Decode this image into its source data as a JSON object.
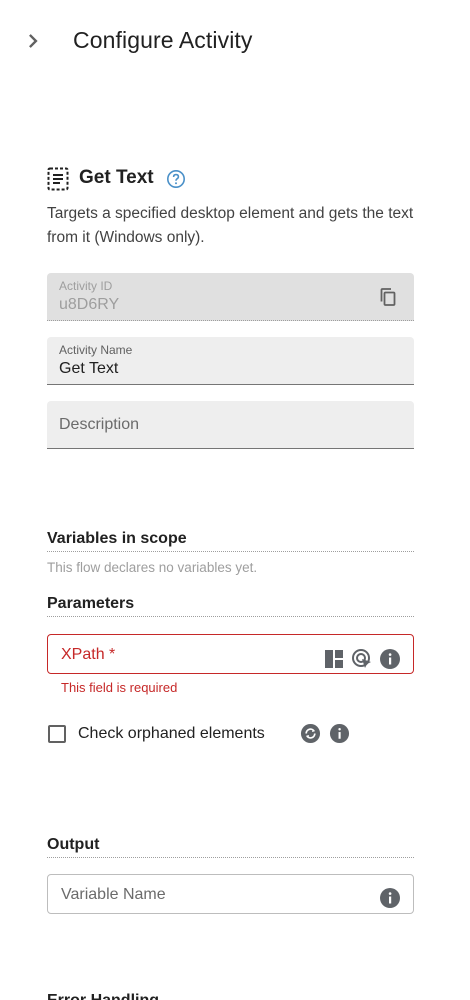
{
  "header": {
    "title": "Configure Activity",
    "back_icon": "chevron-right-icon"
  },
  "activity": {
    "title": "Get Text",
    "icon": "text-document-icon",
    "description": "Targets a specified desktop element and gets the text from it (Windows only)."
  },
  "fields": {
    "activity_id": {
      "label": "Activity ID",
      "value": "u8D6RY"
    },
    "activity_name": {
      "label": "Activity Name",
      "value": "Get Text"
    },
    "description": {
      "placeholder": "Description"
    }
  },
  "variables": {
    "heading": "Variables in scope",
    "empty_text": "This flow declares no variables yet."
  },
  "parameters": {
    "heading": "Parameters",
    "xpath": {
      "placeholder": "XPath *",
      "error": "This field is required"
    },
    "orphaned": {
      "label": "Check orphaned elements",
      "checked": false
    }
  },
  "output": {
    "heading": "Output",
    "placeholder": "Variable Name"
  },
  "next_section": {
    "heading": "Error Handling"
  },
  "colors": {
    "error": "#c62828",
    "field_bg": "#eeeeee",
    "accent": "#1976d2"
  }
}
